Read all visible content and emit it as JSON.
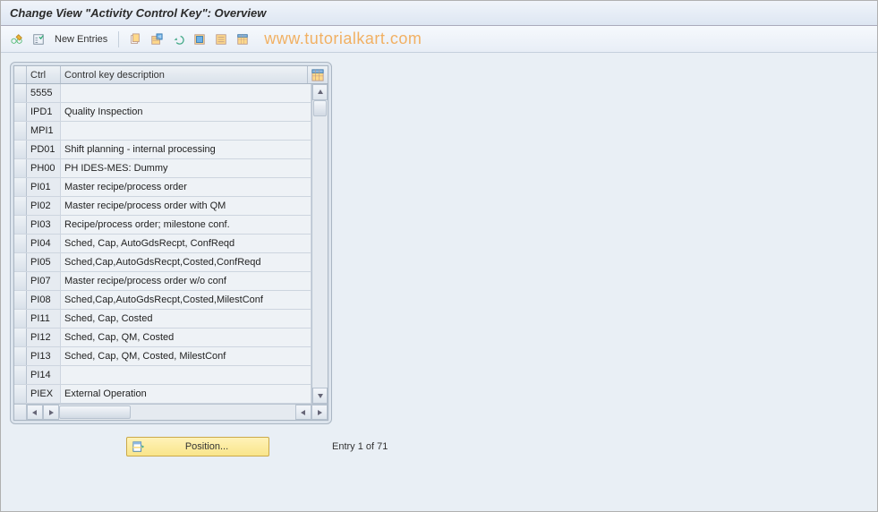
{
  "title": "Change View \"Activity Control Key\": Overview",
  "toolbar": {
    "new_entries_label": "New Entries"
  },
  "watermark": "www.tutorialkart.com",
  "table": {
    "col_ctrl": "Ctrl",
    "col_desc": "Control key description",
    "rows": [
      {
        "ctrl": "5555",
        "desc": ""
      },
      {
        "ctrl": "IPD1",
        "desc": "Quality Inspection"
      },
      {
        "ctrl": "MPI1",
        "desc": ""
      },
      {
        "ctrl": "PD01",
        "desc": "Shift planning - internal processing"
      },
      {
        "ctrl": "PH00",
        "desc": "PH IDES-MES: Dummy"
      },
      {
        "ctrl": "PI01",
        "desc": "Master recipe/process order"
      },
      {
        "ctrl": "PI02",
        "desc": "Master recipe/process order with QM"
      },
      {
        "ctrl": "PI03",
        "desc": "Recipe/process order; milestone conf."
      },
      {
        "ctrl": "PI04",
        "desc": "Sched, Cap, AutoGdsRecpt, ConfReqd"
      },
      {
        "ctrl": "PI05",
        "desc": "Sched,Cap,AutoGdsRecpt,Costed,ConfReqd"
      },
      {
        "ctrl": "PI07",
        "desc": "Master recipe/process order w/o conf"
      },
      {
        "ctrl": "PI08",
        "desc": "Sched,Cap,AutoGdsRecpt,Costed,MilestConf"
      },
      {
        "ctrl": "PI11",
        "desc": "Sched, Cap, Costed"
      },
      {
        "ctrl": "PI12",
        "desc": "Sched, Cap, QM, Costed"
      },
      {
        "ctrl": "PI13",
        "desc": "Sched, Cap, QM, Costed, MilestConf"
      },
      {
        "ctrl": "PI14",
        "desc": ""
      },
      {
        "ctrl": "PIEX",
        "desc": "External Operation"
      }
    ]
  },
  "footer": {
    "position_label": "Position...",
    "entry_text": "Entry 1 of 71"
  }
}
